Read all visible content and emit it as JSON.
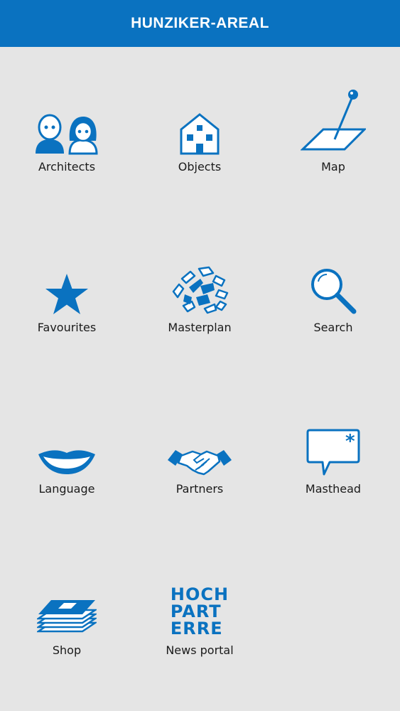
{
  "header": {
    "title": "HUNZIKER-AREAL"
  },
  "colors": {
    "brand_blue": "#0a72c0",
    "background": "#e5e5e5",
    "label_text": "#1a1a1a"
  },
  "menu": {
    "items": [
      {
        "label": "Architects",
        "icon": "architects-icon"
      },
      {
        "label": "Objects",
        "icon": "house-icon"
      },
      {
        "label": "Map",
        "icon": "map-pin-icon"
      },
      {
        "label": "Favourites",
        "icon": "star-icon"
      },
      {
        "label": "Masterplan",
        "icon": "masterplan-icon"
      },
      {
        "label": "Search",
        "icon": "magnifier-icon"
      },
      {
        "label": "Language",
        "icon": "lips-icon"
      },
      {
        "label": "Partners",
        "icon": "handshake-icon"
      },
      {
        "label": "Masthead",
        "icon": "speech-bubble-icon"
      },
      {
        "label": "Shop",
        "icon": "books-stack-icon"
      },
      {
        "label": "News portal",
        "icon": "hochparterre-logo-icon",
        "logo_text": [
          "HOCH",
          "PART",
          "ERRE"
        ]
      }
    ]
  }
}
